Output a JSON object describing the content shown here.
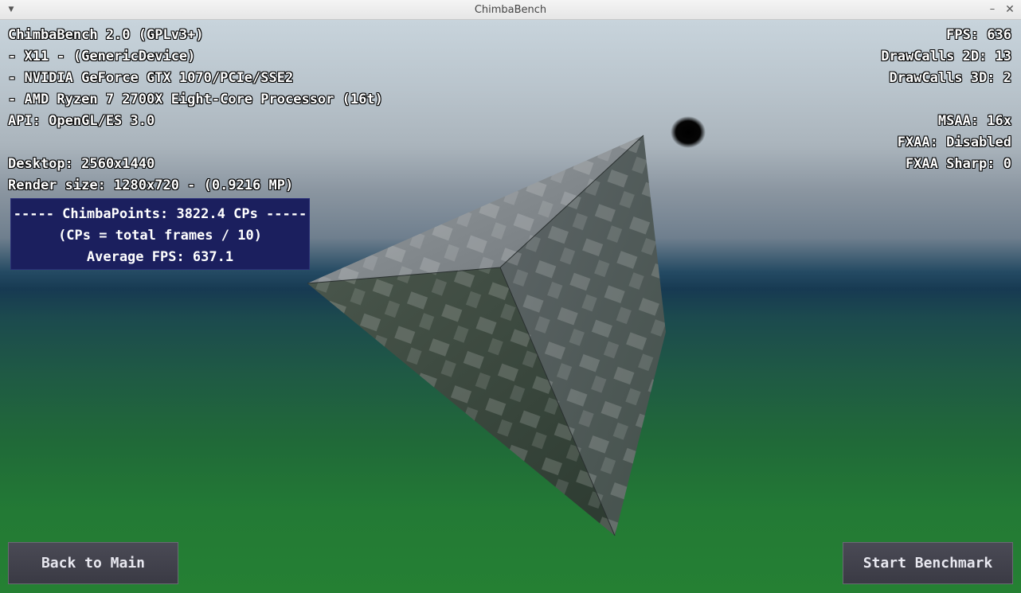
{
  "window": {
    "title": "ChimbaBench",
    "menu_icon": "chevron-down-icon",
    "minimize_icon": "minimize-icon",
    "close_icon": "close-icon",
    "menu_glyph": "▼",
    "minimize_glyph": "–",
    "close_glyph": "✕"
  },
  "hud_left": {
    "line1": "ChimbaBench 2.0 (GPLv3+)",
    "line2": "- X11 - (GenericDevice)",
    "line3": "- NVIDIA GeForce GTX 1070/PCIe/SSE2",
    "line4": "- AMD Ryzen 7 2700X Eight-Core Processor (16t)",
    "line5": "API: OpenGL/ES 3.0",
    "line6": "Desktop: 2560x1440",
    "line7": "Render size: 1280x720 - (0.9216 MP)"
  },
  "hud_right": {
    "fps": "FPS: 636",
    "drawcalls_2d": "DrawCalls 2D: 13",
    "drawcalls_3d": "DrawCalls 3D: 2",
    "msaa": "MSAA: 16x",
    "fxaa": "FXAA: Disabled",
    "fxaa_sharp": "FXAA Sharp: 0"
  },
  "points_box": {
    "line1": "-----  ChimbaPoints: 3822.4 CPs  -----",
    "line2": "(CPs = total frames / 10)",
    "line3": "Average FPS: 637.1"
  },
  "buttons": {
    "back": "Back to Main",
    "start": "Start Benchmark"
  },
  "colors": {
    "panel_bg": "#1b1f5e",
    "button_bg": "#43434d",
    "text": "#ffffff"
  }
}
